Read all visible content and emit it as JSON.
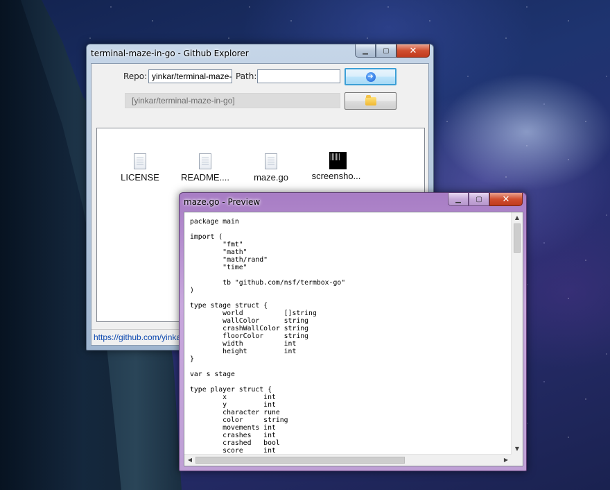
{
  "explorer": {
    "title": "terminal-maze-in-go - Github Explorer",
    "repo_label": "Repo:",
    "repo_value": "yinkar/terminal-maze-in-go",
    "path_label": "Path:",
    "path_value": "",
    "current_path": "[yinkar/terminal-maze-in-go]",
    "go_icon": "go-arrow-icon",
    "open_icon": "folder-icon",
    "files": [
      {
        "name": "LICENSE",
        "icon": "document-icon"
      },
      {
        "name": "README....",
        "icon": "document-icon"
      },
      {
        "name": "maze.go",
        "icon": "document-icon"
      },
      {
        "name": "screensho...",
        "icon": "image-icon"
      }
    ],
    "status_link": "https://github.com/yinkar/terminal-maze-in-go"
  },
  "preview": {
    "title": "maze.go - Preview",
    "code": "package main\n\nimport (\n        \"fmt\"\n        \"math\"\n        \"math/rand\"\n        \"time\"\n\n        tb \"github.com/nsf/termbox-go\"\n)\n\ntype stage struct {\n        world          []string\n        wallColor      string\n        crashWallColor string\n        floorColor     string\n        width          int\n        height         int\n}\n\nvar s stage\n\ntype player struct {\n        x         int\n        y         int\n        character rune\n        color     string\n        movements int\n        crashes   int\n        crashed   bool\n        score     int"
  },
  "colors": {
    "explorer_frame": "#a9bdd6",
    "preview_frame": "#b994d0",
    "close_button": "#c8452a",
    "link": "#0f4ab0"
  }
}
